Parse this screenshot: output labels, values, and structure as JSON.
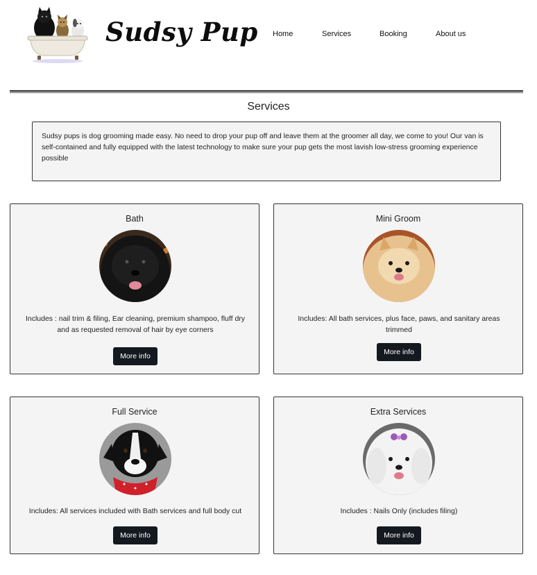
{
  "header": {
    "brand": "Sudsy Pup",
    "nav": [
      {
        "label": "Home"
      },
      {
        "label": "Services"
      },
      {
        "label": "Booking"
      },
      {
        "label": "About us"
      }
    ]
  },
  "main": {
    "title": "Services",
    "intro": "Sudsy pups is dog grooming made easy. No need to drop your pup off and leave them at the groomer all day, we come to you! Our van is self-contained and fully equipped with the latest technology to make sure your pup gets the most lavish low-stress grooming experience possible",
    "cards": [
      {
        "title": "Bath",
        "description": "Includes : nail trim & filing, Ear cleaning, premium shampoo, fluff dry and as requested removal of hair by eye corners",
        "button": "More info",
        "photo": "black-fluffy-dog-photo"
      },
      {
        "title": "Mini Groom",
        "description": "Includes: All bath services, plus face, paws, and sanitary areas trimmed",
        "button": "More info",
        "photo": "pomeranian-dog-photo"
      },
      {
        "title": "Full Service",
        "description": "Includes: All services included with Bath services and full body cut",
        "button": "More info",
        "photo": "black-white-dog-red-bandana-photo"
      },
      {
        "title": "Extra Services",
        "description": "Includes : Nails Only (includes filing)",
        "button": "More info",
        "photo": "white-fluffy-dog-bow-photo"
      }
    ]
  },
  "colors": {
    "card_bg": "#f4f4f4",
    "button_bg": "#14181f",
    "border": "#333333"
  }
}
